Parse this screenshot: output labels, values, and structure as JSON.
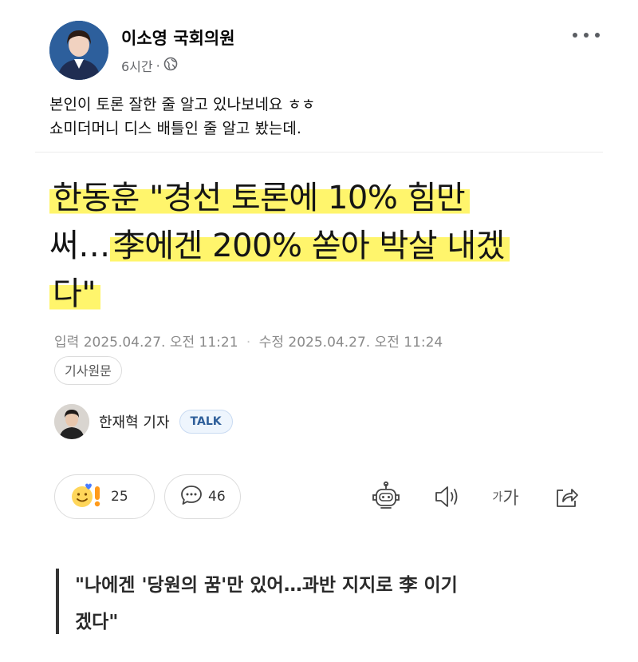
{
  "post": {
    "author": "이소영 국회의원",
    "time": "6시간",
    "separator": "·",
    "audience_icon": "globe-icon",
    "more_icon": "more-horizontal-icon",
    "text_lines": [
      "본인이 토론 잘한 줄 알고 있나보네요 ㅎㅎ",
      "쇼미더머니 디스 배틀인 줄 알고 봤는데."
    ]
  },
  "article": {
    "headline": {
      "line1": "한동훈 \"경선 토론에 10% 힘만",
      "line2_a": "써…",
      "line2_b": "李에겐 200% 쏟아 박살 내겠",
      "line3": "다\""
    },
    "input_label": "입력",
    "input_date": "2025.04.27. 오전 11:21",
    "dot": "·",
    "modified_label": "수정",
    "modified_date": "2025.04.27. 오전 11:24",
    "origin_button": "기사원문",
    "reporter": "한재혁 기자",
    "talk_button": "TALK",
    "reaction_count": "25",
    "comment_count": "46",
    "font_size_label_small": "가",
    "font_size_label_large": "가",
    "quote_lines": [
      "\"나에겐 '당원의 꿈'만 있어…과반 지지로 李 이기",
      "겠다\""
    ]
  },
  "colors": {
    "highlight": "#fff56c",
    "talk_bg": "#eef5fd",
    "talk_text": "#2f5f9a",
    "meta_gray": "#8a8a8a"
  }
}
